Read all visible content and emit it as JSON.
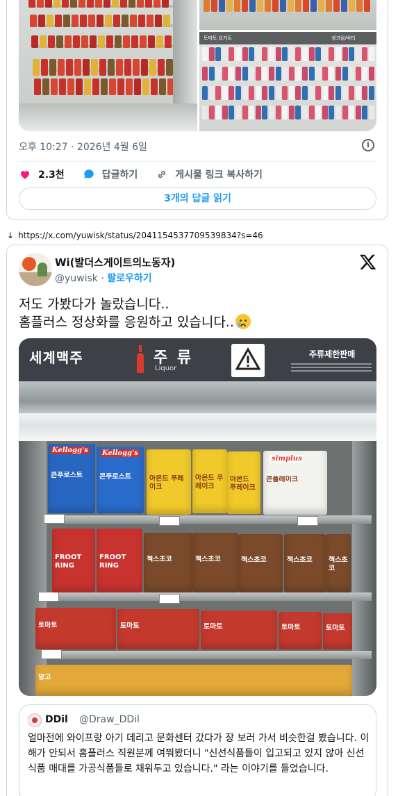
{
  "tweet1": {
    "timestamp": "오후 10:27 · 2026년 4월 6일",
    "like_count": "2.3천",
    "reply_label": "답글하기",
    "copy_link_label": "게시물 링크 복사하기",
    "read_replies_label": "3개의 답글 읽기",
    "photo_b_sign": "토마토 요거트",
    "photo_c_sign": "생크림/버터"
  },
  "url_line": {
    "arrow": "↓",
    "url": "https://x.com/yuwisk/status/2041154537709539834?s=46"
  },
  "tweet2": {
    "display_name": "Wi(발더스게이트의노동자)",
    "handle": "@yuwisk",
    "separator": " · ",
    "follow_label": "팔로우하기",
    "text_line1": "저도 가봤다가 놀랐습니다..",
    "text_line2": "홈플러스 정상화를 응원하고 있습니다..",
    "photo": {
      "sign_left": "세계맥주",
      "sign_center": "주 류",
      "sign_center_sub": "Liquor",
      "sign_right": "주류제한판매",
      "box_labels": [
        "콘푸로스트",
        "콘푸로스트",
        "아몬드 푸레이크",
        "아몬드 푸레이크",
        "아몬드 푸레이크",
        "콘플레이크",
        "FROOT RING",
        "FROOT RING",
        "첵스초코",
        "첵스초코",
        "첵스초코",
        "첵스초코",
        "첵스초코",
        "토마토",
        "토마토",
        "토마토",
        "토마토",
        "토마토",
        "망고"
      ],
      "brand_kelloggs": "Kellogg's",
      "brand_simplus": "simplus"
    },
    "quote": {
      "name": "DDil",
      "handle": "@Draw_DDil",
      "text": "얼마전에 와이프랑 아기 데리고 문화센터 갔다가 장 보러 가서 비슷한걸 봤습니다. 이해가 안되서 홈플러스 직원분께 여쭤봤더니 \"신선식품들이 입고되고 있지 않아 신선식품 매대를 가공식품들로 채워두고 있습니다.\" 라는 이야기를 들었습니다."
    }
  },
  "colors": {
    "accent": "#1d9bf0",
    "like": "#f91880",
    "muted": "#536471",
    "border": "#cfd9de"
  }
}
